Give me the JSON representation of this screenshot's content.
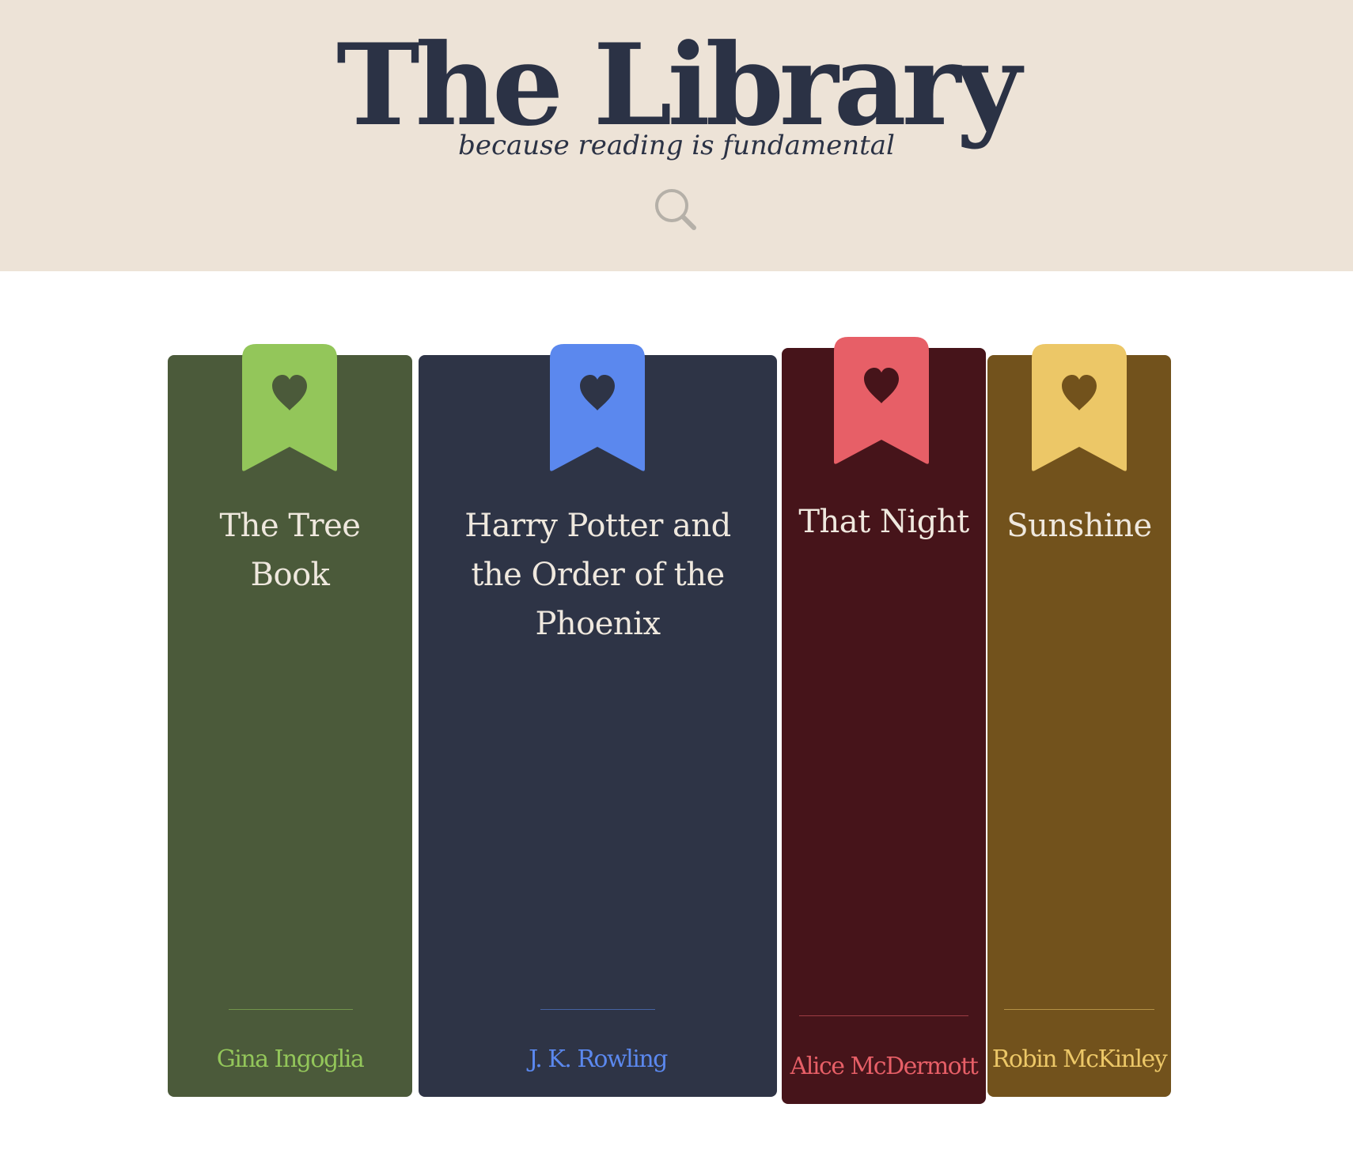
{
  "header": {
    "title": "The Library",
    "tagline": "because reading is fundamental",
    "search_icon": "search-icon"
  },
  "books": [
    {
      "title": "The Tree Book",
      "author": "Gina Ingoglia",
      "spine_color": "#4b5a3a",
      "accent_color": "#93c65a",
      "icon": "heart-bookmark-icon"
    },
    {
      "title": "Harry Potter and the Order of the Phoenix",
      "author": "J. K. Rowling",
      "spine_color": "#2e3446",
      "accent_color": "#5b88ee",
      "icon": "heart-bookmark-icon"
    },
    {
      "title": "That Night",
      "author": "Alice McDermott",
      "spine_color": "#46141a",
      "accent_color": "#e75f67",
      "icon": "heart-bookmark-icon"
    },
    {
      "title": "Sunshine",
      "author": "Robin McKinley",
      "spine_color": "#72521c",
      "accent_color": "#ecc767",
      "icon": "heart-bookmark-icon"
    }
  ]
}
